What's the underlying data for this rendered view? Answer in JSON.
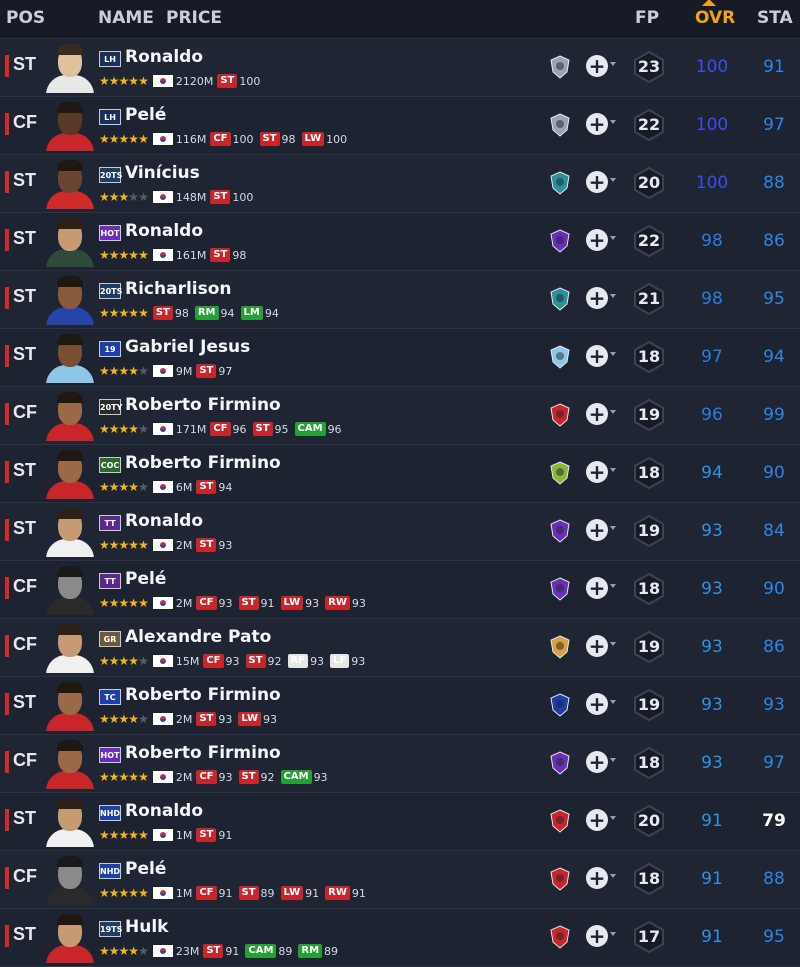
{
  "header": {
    "pos": "POS",
    "name": "NAME",
    "price": "PRICE",
    "fp": "FP",
    "ovr": "OVR",
    "sta": "STA"
  },
  "colors": {
    "ovr_100": "#3a4ef0",
    "ovr_high": "#2a7de0",
    "ovr_mid": "#2b94e6",
    "pos_st": "#c8262a",
    "pos_cf": "#c8262a",
    "pos_cam": "#25a035",
    "pos_rm": "#25a035",
    "pos_lm": "#25a035",
    "pos_lw": "#c8262a",
    "pos_rw": "#c8262a",
    "pos_rf": "#e6e6e6",
    "pos_lf": "#e6e6e6",
    "accent": "#f0a31a"
  },
  "players": [
    {
      "pos": "ST",
      "season": "LH",
      "season_color": "#1a2f5a",
      "name": "Ronaldo",
      "stars": 5,
      "flag": true,
      "price": "2120M",
      "positions": [
        {
          "p": "ST",
          "v": "100",
          "c": "#c8262a"
        }
      ],
      "club_icon": "shield-icon",
      "club_color": "#98a3b3",
      "fp": "23",
      "ovr": "100",
      "sta": "91",
      "ovr_color": "#3a4ef0",
      "sta_color": "#2b86e6",
      "skin": "#e0c19b",
      "shirt": "#e8e8e8",
      "hair": "#3a2b20"
    },
    {
      "pos": "CF",
      "season": "LH",
      "season_color": "#1a2f5a",
      "name": "Pelé",
      "stars": 5,
      "flag": true,
      "price": "116M",
      "positions": [
        {
          "p": "CF",
          "v": "100",
          "c": "#c8262a"
        },
        {
          "p": "ST",
          "v": "98",
          "c": "#c8262a"
        },
        {
          "p": "LW",
          "v": "100",
          "c": "#c8262a"
        }
      ],
      "club_icon": "shield-icon",
      "club_color": "#98a3b3",
      "fp": "22",
      "ovr": "100",
      "sta": "97",
      "ovr_color": "#3a4ef0",
      "sta_color": "#2b86e6",
      "skin": "#5a3a26",
      "shirt": "#c8262a",
      "hair": "#1e1712"
    },
    {
      "pos": "ST",
      "season": "20TS",
      "season_color": "#1f3c63",
      "name": "Vinícius",
      "stars": 3,
      "flag": true,
      "price": "148M",
      "positions": [
        {
          "p": "ST",
          "v": "100",
          "c": "#c8262a"
        }
      ],
      "club_icon": "tots-icon",
      "club_color": "#2d8f9a",
      "fp": "20",
      "ovr": "100",
      "sta": "88",
      "ovr_color": "#3a4ef0",
      "sta_color": "#2b86e6",
      "skin": "#6a4630",
      "shirt": "#d02a2a",
      "hair": "#1e1712"
    },
    {
      "pos": "ST",
      "season": "HOT",
      "season_color": "#6a2fb4",
      "name": "Ronaldo",
      "stars": 5,
      "flag": true,
      "price": "161M",
      "positions": [
        {
          "p": "ST",
          "v": "98",
          "c": "#c8262a"
        }
      ],
      "club_icon": "hot-badge-icon",
      "club_color": "#6a2fb4",
      "fp": "22",
      "ovr": "98",
      "sta": "86",
      "ovr_color": "#2a7de0",
      "sta_color": "#2b86e6",
      "skin": "#c69b74",
      "shirt": "#2f4a3a",
      "hair": "#2c2018"
    },
    {
      "pos": "ST",
      "season": "20TS",
      "season_color": "#1f3c63",
      "name": "Richarlison",
      "stars": 5,
      "flag": false,
      "price": "",
      "positions": [
        {
          "p": "ST",
          "v": "98",
          "c": "#c8262a"
        },
        {
          "p": "RM",
          "v": "94",
          "c": "#25a035"
        },
        {
          "p": "LM",
          "v": "94",
          "c": "#25a035"
        }
      ],
      "club_icon": "tots-icon",
      "club_color": "#2d8f9a",
      "fp": "21",
      "ovr": "98",
      "sta": "95",
      "ovr_color": "#2a7de0",
      "sta_color": "#2b86e6",
      "skin": "#8a5a3c",
      "shirt": "#2545a8",
      "hair": "#1e1712"
    },
    {
      "pos": "ST",
      "season": "19",
      "season_color": "#1f3fa8",
      "name": "Gabriel Jesus",
      "stars": 4,
      "flag": true,
      "price": "9M",
      "positions": [
        {
          "p": "ST",
          "v": "97",
          "c": "#c8262a"
        }
      ],
      "club_icon": "man-city-icon",
      "club_color": "#8ec6ea",
      "fp": "18",
      "ovr": "97",
      "sta": "94",
      "ovr_color": "#2a7de0",
      "sta_color": "#2b86e6",
      "skin": "#7a4e34",
      "shirt": "#8ec6ea",
      "hair": "#1e1712"
    },
    {
      "pos": "CF",
      "season": "20TY",
      "season_color": "#2b2b2b",
      "name": "Roberto Firmino",
      "stars": 4,
      "flag": true,
      "price": "171M",
      "positions": [
        {
          "p": "CF",
          "v": "96",
          "c": "#c8262a"
        },
        {
          "p": "ST",
          "v": "95",
          "c": "#c8262a"
        },
        {
          "p": "CAM",
          "v": "96",
          "c": "#25a035"
        }
      ],
      "club_icon": "liverpool-icon",
      "club_color": "#c8262a",
      "fp": "19",
      "ovr": "96",
      "sta": "99",
      "ovr_color": "#2a7de0",
      "sta_color": "#2b86e6",
      "skin": "#9a6a48",
      "shirt": "#c8262a",
      "hair": "#1e1712"
    },
    {
      "pos": "ST",
      "season": "COC",
      "season_color": "#2c6a2c",
      "name": "Roberto Firmino",
      "stars": 4,
      "flag": true,
      "price": "6M",
      "positions": [
        {
          "p": "ST",
          "v": "94",
          "c": "#c8262a"
        }
      ],
      "club_icon": "coc-badge-icon",
      "club_color": "#8ab83a",
      "fp": "18",
      "ovr": "94",
      "sta": "90",
      "ovr_color": "#2b94e6",
      "sta_color": "#2b86e6",
      "skin": "#9a6a48",
      "shirt": "#c8262a",
      "hair": "#1e1712"
    },
    {
      "pos": "ST",
      "season": "TT",
      "season_color": "#5a2a8a",
      "name": "Ronaldo",
      "stars": 5,
      "flag": true,
      "price": "2M",
      "positions": [
        {
          "p": "ST",
          "v": "93",
          "c": "#c8262a"
        }
      ],
      "club_icon": "tt-badge-icon",
      "club_color": "#6a2fb4",
      "fp": "19",
      "ovr": "93",
      "sta": "84",
      "ovr_color": "#2b94e6",
      "sta_color": "#2b86e6",
      "skin": "#c69b74",
      "shirt": "#f0f0f0",
      "hair": "#2c2018"
    },
    {
      "pos": "CF",
      "season": "TT",
      "season_color": "#5a2a8a",
      "name": "Pelé",
      "stars": 5,
      "flag": true,
      "price": "2M",
      "positions": [
        {
          "p": "CF",
          "v": "93",
          "c": "#c8262a"
        },
        {
          "p": "ST",
          "v": "91",
          "c": "#c8262a"
        },
        {
          "p": "LW",
          "v": "93",
          "c": "#c8262a"
        },
        {
          "p": "RW",
          "v": "93",
          "c": "#c8262a"
        }
      ],
      "club_icon": "tt-badge-icon",
      "club_color": "#6a2fb4",
      "fp": "18",
      "ovr": "93",
      "sta": "90",
      "ovr_color": "#2b94e6",
      "sta_color": "#2b86e6",
      "skin": "#8a8a8a",
      "shirt": "#2a2a2a",
      "hair": "#1a1a1a"
    },
    {
      "pos": "CF",
      "season": "GR",
      "season_color": "#6a5a3a",
      "name": "Alexandre Pato",
      "stars": 4,
      "flag": true,
      "price": "15M",
      "positions": [
        {
          "p": "CF",
          "v": "93",
          "c": "#c8262a"
        },
        {
          "p": "ST",
          "v": "92",
          "c": "#c8262a"
        },
        {
          "p": "RF",
          "v": "93",
          "c": "#e6e6e6"
        },
        {
          "p": "LF",
          "v": "93",
          "c": "#e6e6e6"
        }
      ],
      "club_icon": "gr-badge-icon",
      "club_color": "#d8a040",
      "fp": "19",
      "ovr": "93",
      "sta": "86",
      "ovr_color": "#2b94e6",
      "sta_color": "#2b86e6",
      "skin": "#c69b74",
      "shirt": "#f0f0f0",
      "hair": "#2c2018"
    },
    {
      "pos": "ST",
      "season": "TC",
      "season_color": "#1f3fa8",
      "name": "Roberto Firmino",
      "stars": 4,
      "flag": true,
      "price": "2M",
      "positions": [
        {
          "p": "ST",
          "v": "93",
          "c": "#c8262a"
        },
        {
          "p": "LW",
          "v": "93",
          "c": "#c8262a"
        }
      ],
      "club_icon": "tc-badge-icon",
      "club_color": "#1f3fa8",
      "fp": "19",
      "ovr": "93",
      "sta": "93",
      "ovr_color": "#2b94e6",
      "sta_color": "#2b86e6",
      "skin": "#9a6a48",
      "shirt": "#c8262a",
      "hair": "#1e1712"
    },
    {
      "pos": "CF",
      "season": "HOT",
      "season_color": "#6a2fb4",
      "name": "Roberto Firmino",
      "stars": 5,
      "flag": true,
      "price": "2M",
      "positions": [
        {
          "p": "CF",
          "v": "93",
          "c": "#c8262a"
        },
        {
          "p": "ST",
          "v": "92",
          "c": "#c8262a"
        },
        {
          "p": "CAM",
          "v": "93",
          "c": "#25a035"
        }
      ],
      "club_icon": "hot-badge-icon",
      "club_color": "#6a2fb4",
      "fp": "18",
      "ovr": "93",
      "sta": "97",
      "ovr_color": "#2b94e6",
      "sta_color": "#2b86e6",
      "skin": "#9a6a48",
      "shirt": "#c8262a",
      "hair": "#1e1712"
    },
    {
      "pos": "ST",
      "season": "NHD",
      "season_color": "#1f3fa8",
      "name": "Ronaldo",
      "stars": 5,
      "flag": true,
      "price": "1M",
      "positions": [
        {
          "p": "ST",
          "v": "91",
          "c": "#c8262a"
        }
      ],
      "club_icon": "nhd-badge-icon",
      "club_color": "#c8262a",
      "fp": "20",
      "ovr": "91",
      "sta": "79",
      "ovr_color": "#2b94e6",
      "sta_color": "#ffffff",
      "skin": "#c69b74",
      "shirt": "#f0f0f0",
      "hair": "#2c2018"
    },
    {
      "pos": "CF",
      "season": "NHD",
      "season_color": "#1f3fa8",
      "name": "Pelé",
      "stars": 5,
      "flag": true,
      "price": "1M",
      "positions": [
        {
          "p": "CF",
          "v": "91",
          "c": "#c8262a"
        },
        {
          "p": "ST",
          "v": "89",
          "c": "#c8262a"
        },
        {
          "p": "LW",
          "v": "91",
          "c": "#c8262a"
        },
        {
          "p": "RW",
          "v": "91",
          "c": "#c8262a"
        }
      ],
      "club_icon": "nhd-badge-icon",
      "club_color": "#c8262a",
      "fp": "18",
      "ovr": "91",
      "sta": "88",
      "ovr_color": "#2b94e6",
      "sta_color": "#2b86e6",
      "skin": "#8a8a8a",
      "shirt": "#2a2a2a",
      "hair": "#1a1a1a"
    },
    {
      "pos": "ST",
      "season": "19TS",
      "season_color": "#1f3c63",
      "name": "Hulk",
      "stars": 4,
      "flag": true,
      "price": "23M",
      "positions": [
        {
          "p": "ST",
          "v": "91",
          "c": "#c8262a"
        },
        {
          "p": "CAM",
          "v": "89",
          "c": "#25a035"
        },
        {
          "p": "RM",
          "v": "89",
          "c": "#25a035"
        }
      ],
      "club_icon": "shanghai-icon",
      "club_color": "#c8262a",
      "fp": "17",
      "ovr": "91",
      "sta": "95",
      "ovr_color": "#2b94e6",
      "sta_color": "#2b86e6",
      "skin": "#c69b74",
      "shirt": "#c8262a",
      "hair": "#1e1712"
    }
  ]
}
